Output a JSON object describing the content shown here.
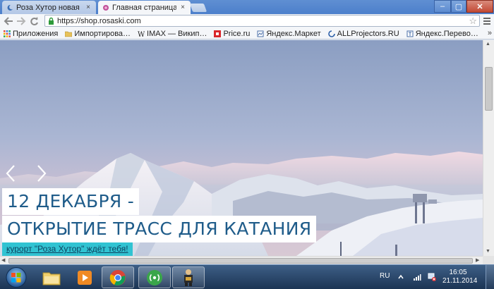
{
  "browser": {
    "tabs": [
      {
        "title": "Роза Хутор новая",
        "close": "×",
        "active": false
      },
      {
        "title": "Главная страница |",
        "close": "×",
        "active": true
      }
    ],
    "address": "https://shop.rosaski.com",
    "star_glyph": "☆",
    "window_controls": {
      "minimize": "–",
      "maximize": "▢",
      "close": "✕"
    }
  },
  "bookmarks": [
    {
      "label": "Приложения",
      "icon": "apps-grid-icon"
    },
    {
      "label": "Импортирова…",
      "icon": "folder-icon"
    },
    {
      "label": "IMAX — Викип…",
      "icon": "wikipedia-icon"
    },
    {
      "label": "Price.ru",
      "icon": "price-ru-icon"
    },
    {
      "label": "Яндекс.Маркет",
      "icon": "yandex-market-icon"
    },
    {
      "label": "ALLProjectors.RU",
      "icon": "allprojectors-icon"
    },
    {
      "label": "Яндекс.Перево…",
      "icon": "yandex-translate-icon"
    }
  ],
  "bookmarks_more": "»",
  "hero": {
    "headline_line1": "12 ДЕКАБРЯ -",
    "headline_line2": "ОТКРЫТИЕ ТРАСС ДЛЯ КАТАНИЯ",
    "tagline": "курорт \"Роза Хутор\" ждёт тебя!",
    "colors": {
      "headline_text": "#1f5c8a",
      "tagline_bg": "#31c3d2"
    }
  },
  "taskbar": {
    "apps": [
      {
        "name": "explorer",
        "icon": "folder-icon"
      },
      {
        "name": "media-player",
        "icon": "media-player-icon"
      },
      {
        "name": "chrome",
        "icon": "chrome-icon"
      },
      {
        "name": "network",
        "icon": "wireless-icon"
      },
      {
        "name": "app",
        "icon": "figure-icon"
      }
    ],
    "language": "RU",
    "time": "16:05",
    "date": "21.11.2014"
  }
}
